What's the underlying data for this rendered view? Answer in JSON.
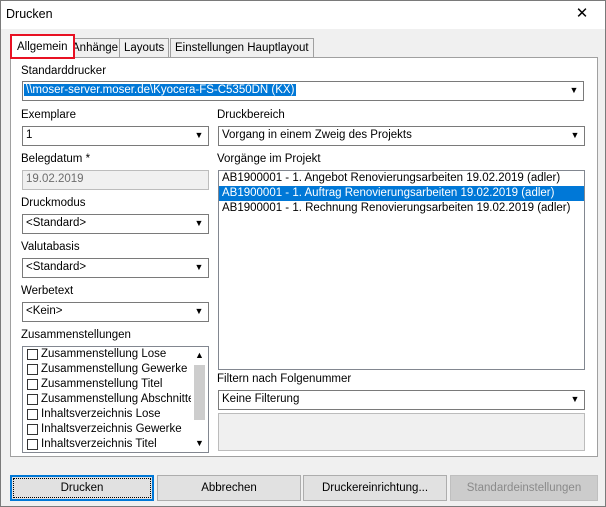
{
  "window": {
    "title": "Drucken",
    "close_symbol": "✕"
  },
  "tabs": [
    {
      "label": "Allgemein"
    },
    {
      "label": "Anhänge"
    },
    {
      "label": "Layouts"
    },
    {
      "label": "Einstellungen Hauptlayout"
    }
  ],
  "standarddrucker": {
    "label": "Standarddrucker",
    "value": "\\\\moser-server.moser.de\\Kyocera-FS-C5350DN (KX)"
  },
  "exemplare": {
    "label": "Exemplare",
    "value": "1"
  },
  "druckbereich": {
    "label": "Druckbereich",
    "value": "Vorgang in einem Zweig des Projekts"
  },
  "belegdatum": {
    "label": "Belegdatum *",
    "value": "19.02.2019"
  },
  "druckmodus": {
    "label": "Druckmodus",
    "value": "<Standard>"
  },
  "valutabasis": {
    "label": "Valutabasis",
    "value": "<Standard>"
  },
  "werbetext": {
    "label": "Werbetext",
    "value": "<Kein>"
  },
  "vorgaenge": {
    "label": "Vorgänge im Projekt",
    "items": [
      {
        "text": "AB1900001 - 1. Angebot Renovierungsarbeiten 19.02.2019 (adler)"
      },
      {
        "text": "AB1900001 - 1. Auftrag Renovierungsarbeiten 19.02.2019 (adler)"
      },
      {
        "text": "AB1900001 - 1. Rechnung Renovierungsarbeiten 19.02.2019 (adler)"
      }
    ]
  },
  "zusammenstellungen": {
    "label": "Zusammenstellungen",
    "items": [
      {
        "text": "Zusammenstellung Lose"
      },
      {
        "text": "Zusammenstellung Gewerke"
      },
      {
        "text": "Zusammenstellung Titel"
      },
      {
        "text": "Zusammenstellung Abschnitte"
      },
      {
        "text": "Inhaltsverzeichnis Lose"
      },
      {
        "text": "Inhaltsverzeichnis Gewerke"
      },
      {
        "text": "Inhaltsverzeichnis Titel"
      }
    ]
  },
  "filter": {
    "label": "Filtern nach Folgenummer",
    "value": "Keine Filterung"
  },
  "buttons": {
    "drucken": "Drucken",
    "abbrechen": "Abbrechen",
    "druckereinrichtung": "Druckereinrichtung...",
    "standardeinstellungen": "Standardeinstellungen"
  },
  "icons": {
    "combo_arrow": "chevron-down-icon",
    "scroll_up": "chevron-up-icon"
  },
  "colors": {
    "selection": "#0078d7",
    "active_tab_highlight": "#e81123"
  }
}
